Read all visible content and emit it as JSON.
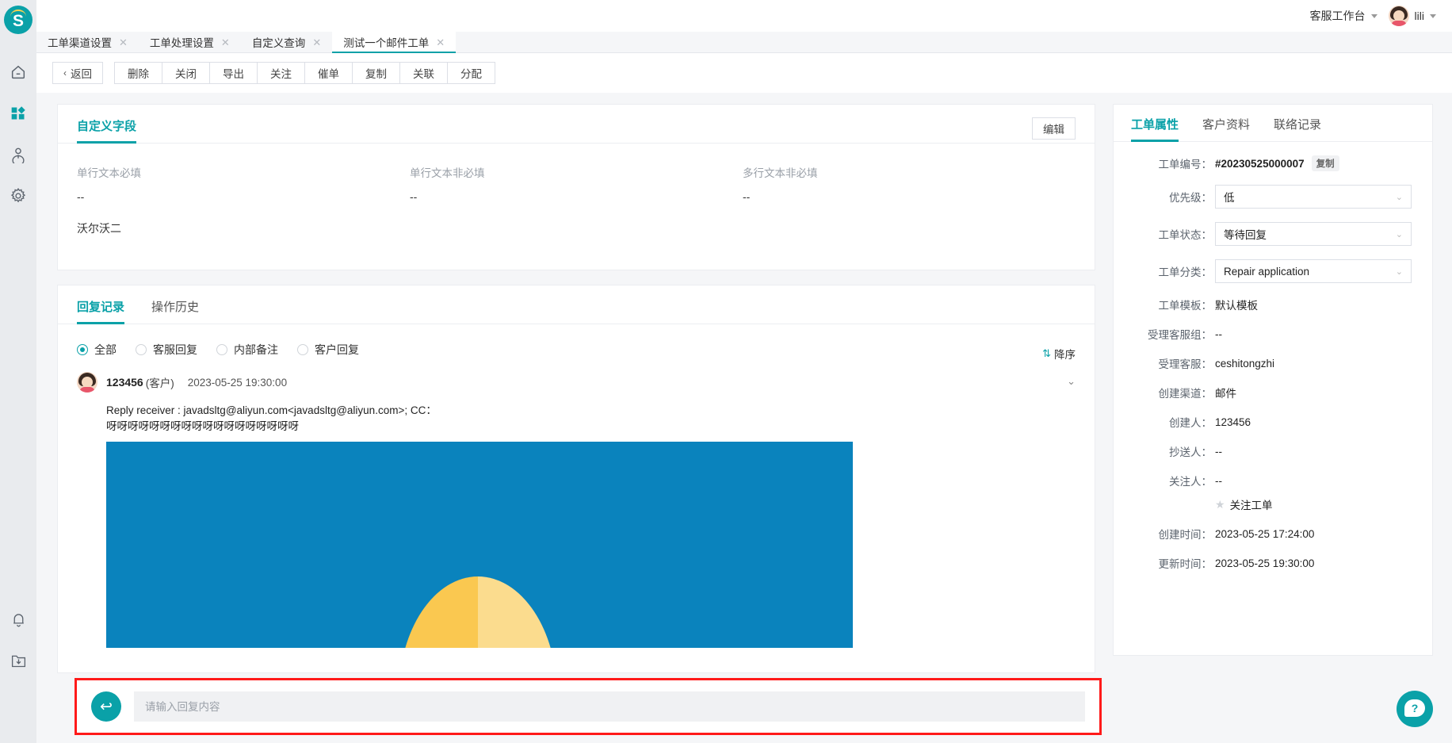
{
  "brand": {
    "logo_letter": "S",
    "accent": "#0aa1a8"
  },
  "topbar": {
    "workspace": "客服工作台",
    "username": "lili"
  },
  "rail": {
    "items": [
      {
        "name": "home-icon",
        "label": "首页"
      },
      {
        "name": "apps-icon",
        "label": "应用"
      },
      {
        "name": "user-icon",
        "label": "用户"
      },
      {
        "name": "settings-icon",
        "label": "设置"
      },
      {
        "name": "bell-icon",
        "label": "通知"
      },
      {
        "name": "download-folder-icon",
        "label": "下载"
      }
    ]
  },
  "tabs": [
    {
      "label": "工单渠道设置",
      "active": false
    },
    {
      "label": "工单处理设置",
      "active": false
    },
    {
      "label": "自定义查询",
      "active": false
    },
    {
      "label": "测试一个邮件工单",
      "active": true
    }
  ],
  "toolbar": {
    "back": "返回",
    "buttons": [
      "删除",
      "关闭",
      "导出",
      "关注",
      "催单",
      "复制",
      "关联",
      "分配"
    ]
  },
  "custom_fields": {
    "tab_label": "自定义字段",
    "edit_label": "编辑",
    "fields": [
      {
        "label": "单行文本必填",
        "value": "--"
      },
      {
        "label": "单行文本非必填",
        "value": "--"
      },
      {
        "label": "多行文本非必填",
        "value": "--"
      }
    ],
    "extra_value": "沃尔沃二"
  },
  "reply_section": {
    "tabs": [
      {
        "label": "回复记录",
        "active": true
      },
      {
        "label": "操作历史",
        "active": false
      }
    ],
    "sort_label": "降序",
    "sort_icon": "sort-descending-icon",
    "filters": [
      {
        "label": "全部",
        "selected": true
      },
      {
        "label": "客服回复",
        "selected": false
      },
      {
        "label": "内部备注",
        "selected": false
      },
      {
        "label": "客户回复",
        "selected": false
      }
    ],
    "message": {
      "author": "123456",
      "role": "(客户)",
      "time": "2023-05-25 19:30:00",
      "line1": "Reply receiver : javadsltg@aliyun.com<javadsltg@aliyun.com>; CC：",
      "line2": "呀呀呀呀呀呀呀呀呀呀呀呀呀呀呀呀呀呀",
      "attachment_image": {
        "background_color": "#0a83bd",
        "sun_left_color": "#fac850",
        "sun_right_color": "#fbdc8e"
      }
    }
  },
  "reply_bar": {
    "placeholder": "请输入回复内容",
    "icon": "reply-arrow-icon",
    "highlight_color": "#ff1a1a"
  },
  "right_panel": {
    "tabs": [
      {
        "label": "工单属性",
        "active": true
      },
      {
        "label": "客户资料",
        "active": false
      },
      {
        "label": "联络记录",
        "active": false
      }
    ],
    "ticket_no_label": "工单编号：",
    "ticket_no": "#20230525000007",
    "copy_label": "复制",
    "priority_label": "优先级：",
    "priority_value": "低",
    "status_label": "工单状态：",
    "status_value": "等待回复",
    "category_label": "工单分类：",
    "category_value": "Repair application",
    "rows": [
      {
        "label": "工单模板：",
        "value": "默认模板"
      },
      {
        "label": "受理客服组：",
        "value": "--"
      },
      {
        "label": "受理客服：",
        "value": "ceshitongzhi"
      },
      {
        "label": "创建渠道：",
        "value": "邮件"
      },
      {
        "label": "创建人：",
        "value": "123456"
      },
      {
        "label": "抄送人：",
        "value": "--"
      },
      {
        "label": "关注人：",
        "value": "--"
      }
    ],
    "watch_label": "关注工单",
    "created_label": "创建时间：",
    "created_value": "2023-05-25 17:24:00",
    "updated_label": "更新时间：",
    "updated_value": "2023-05-25 19:30:00"
  },
  "help": {
    "glyph": "?"
  }
}
